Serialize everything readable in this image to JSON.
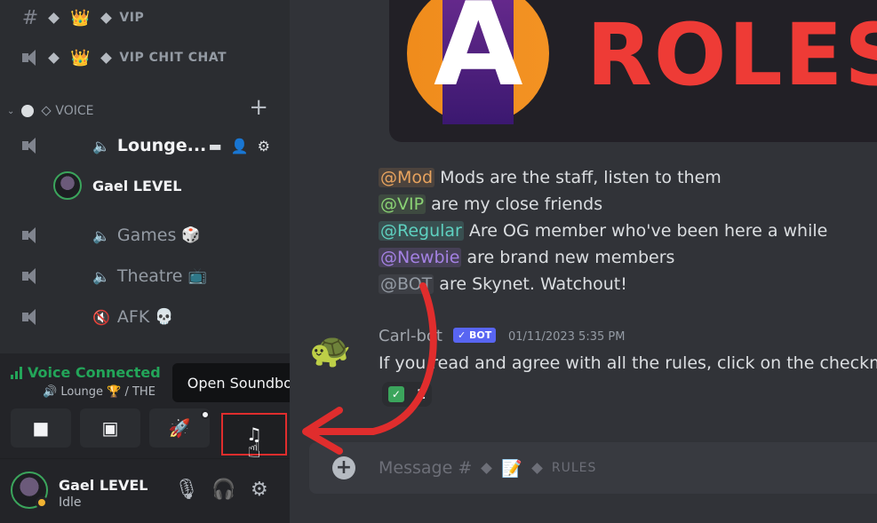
{
  "sidebar": {
    "channels": [
      {
        "name": "VIP",
        "icon": "text-channel-icon"
      },
      {
        "name": "VIP CHIT CHAT",
        "icon": "announcement-icon"
      }
    ],
    "category": {
      "name": "VOICE"
    },
    "voice_channels": [
      {
        "name": "Lounge...",
        "emoji": "",
        "active": true
      },
      {
        "name": "Games",
        "emoji": "🎲"
      },
      {
        "name": "Theatre",
        "emoji": "📺"
      },
      {
        "name": "AFK",
        "emoji": "💀"
      }
    ],
    "voice_user": {
      "name": "Gael LEVEL"
    }
  },
  "voice_panel": {
    "status": "Voice Connected",
    "subtitle": "🔊 Lounge 🏆 / THE",
    "tooltip": "Open Soundboard"
  },
  "user_panel": {
    "name": "Gael LEVEL",
    "status": "Idle"
  },
  "main": {
    "banner_text": "ROLES",
    "banner_letter": "A",
    "role_lines": [
      {
        "role": "@Mod",
        "text": " Mods are the staff, listen to them"
      },
      {
        "role": "@VIP",
        "text": " are my close friends"
      },
      {
        "role": "@Regular",
        "text": " Are OG member who've been here a while"
      },
      {
        "role": "@Newbie",
        "text": " are brand new members"
      },
      {
        "role": "@BOT",
        "text": " are Skynet. Watchout!"
      }
    ],
    "message": {
      "author": "Carl-bot",
      "tag": "✓ BOT",
      "timestamp": "01/11/2023 5:35 PM",
      "body": "If you read and agree with all the rules, click on the checkmar",
      "reaction_count": "1"
    },
    "composer": {
      "prefix": "Message #",
      "channel": "RULES"
    }
  },
  "colors": {
    "accent_red": "#e02d2d",
    "voice_green": "#23a559",
    "blurple": "#5865f2"
  }
}
